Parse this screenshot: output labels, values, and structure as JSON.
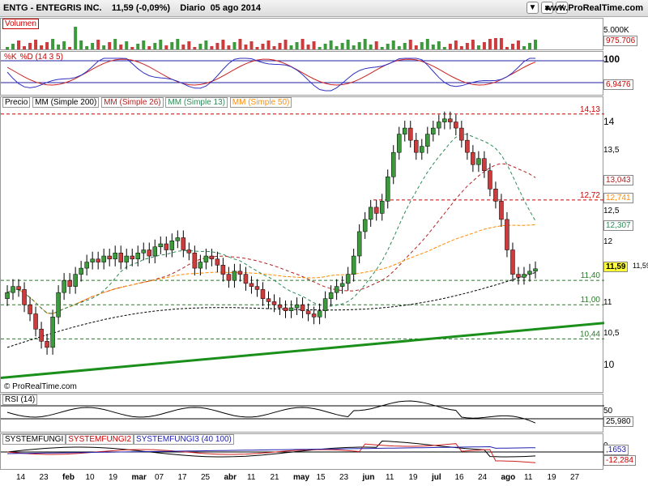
{
  "header": {
    "symbol": "ENTG - ENTEGRIS INC.",
    "last": "11,59 (-0,09%)",
    "period": "Diario",
    "date": "05 ago 2014",
    "site": "www.ProRealTime.com",
    "icons": [
      "down-arrow-icon",
      "up-arrow-icon",
      "close-icon"
    ]
  },
  "volume": {
    "label": "Volumen",
    "axis": [
      "5.000K"
    ],
    "last": "975.706"
  },
  "stoch": {
    "label_k": "%K",
    "label_d": "%D (14 3 5)",
    "axis": [
      "100"
    ],
    "last": "6,9476"
  },
  "price": {
    "label": "Precio",
    "ma200": "MM (Simple 200)",
    "ma26": "MM (Simple 26)",
    "ma13": "MM (Simple 13)",
    "ma50": "MM (Simple 50)",
    "axis": [
      "14",
      "13,5",
      "12,5",
      "12",
      "11",
      "10,5",
      "10"
    ],
    "levels": [
      "14,13",
      "12,72",
      "11,40",
      "11,00",
      "10,44"
    ],
    "tags": {
      "ma26": "13,043",
      "ma50": "12,741",
      "ma13": "12,307",
      "last": "11,59",
      "ma200": "11,59"
    },
    "copyright": "© ProRealTime.com"
  },
  "rsi": {
    "label": "RSI (14)",
    "axis": [
      "50"
    ],
    "last": "25,980"
  },
  "fungi": {
    "label1": "SYSTEMFUNGI",
    "label2": "SYSTEMFUNGI2",
    "label3": "SYSTEMFUNGI3 (40 100)",
    "axis": [
      "0"
    ],
    "val1": ",1653",
    "val2": "-12,284"
  },
  "xaxis": [
    "14",
    "23",
    "feb",
    "10",
    "19",
    "mar",
    "07",
    "17",
    "25",
    "abr",
    "11",
    "21",
    "may",
    "15",
    "23",
    "jun",
    "11",
    "19",
    "jul",
    "16",
    "24",
    "ago",
    "11",
    "19",
    "27"
  ],
  "colors": {
    "up": "#3c9a3c",
    "down": "#cc3c3c",
    "ma200": "#000000",
    "ma26": "#b22222",
    "ma13": "#2e8b57",
    "ma50": "#ff8c00",
    "trend": "#1a8f1a",
    "stoch_k": "#3030c0",
    "stoch_d": "#cc2020"
  },
  "chart_data": {
    "type": "candlestick",
    "ylim": [
      9.7,
      14.3
    ],
    "closes": [
      11.2,
      11.3,
      11.25,
      11.0,
      10.85,
      10.6,
      10.4,
      10.3,
      10.8,
      11.2,
      11.4,
      11.3,
      11.5,
      11.6,
      11.7,
      11.75,
      11.7,
      11.8,
      11.75,
      11.85,
      11.7,
      11.8,
      11.75,
      11.85,
      11.9,
      11.8,
      11.95,
      12.0,
      11.9,
      12.05,
      12.1,
      11.9,
      11.85,
      11.6,
      11.7,
      11.8,
      11.75,
      11.65,
      11.5,
      11.4,
      11.55,
      11.5,
      11.35,
      11.3,
      11.25,
      11.1,
      11.05,
      11.0,
      10.95,
      10.9,
      10.95,
      11.0,
      10.9,
      10.85,
      10.8,
      10.9,
      11.1,
      11.2,
      11.3,
      11.35,
      11.5,
      11.8,
      12.2,
      12.4,
      12.6,
      12.5,
      12.7,
      13.1,
      13.5,
      13.8,
      13.9,
      13.7,
      13.5,
      13.6,
      13.8,
      13.9,
      14.0,
      14.05,
      14.0,
      13.9,
      13.7,
      13.5,
      13.3,
      13.4,
      13.2,
      12.9,
      12.7,
      12.4,
      11.9,
      11.5,
      11.45,
      11.5,
      11.55,
      11.59
    ],
    "levels": [
      14.13,
      12.72,
      11.4,
      11.0,
      10.44
    ],
    "last_price": 11.59
  }
}
